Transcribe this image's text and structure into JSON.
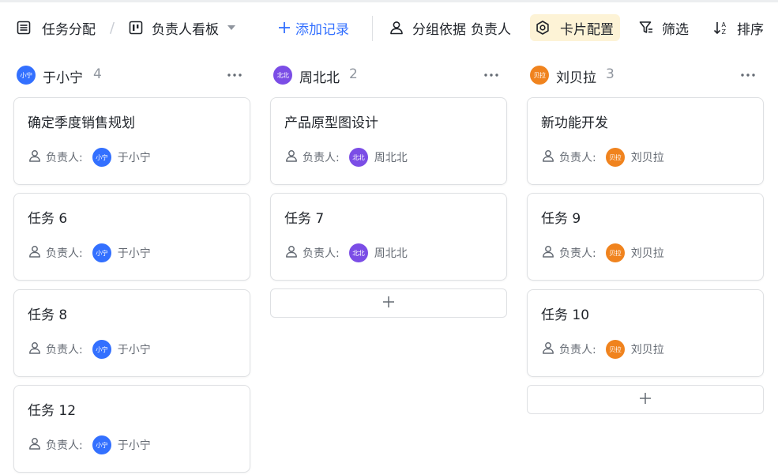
{
  "toolbar": {
    "view_title": "任务分配",
    "board_name": "负责人看板",
    "add_record": "添加记录",
    "group_by_label": "分组依据",
    "group_by_value": "负责人",
    "card_config": "卡片配置",
    "filter": "筛选",
    "sort": "排序"
  },
  "colors": {
    "accent": "#3370ff",
    "card_config_bg": "#fdf3d6",
    "avatar_blue": "#3370ff",
    "avatar_purple": "#7b4de6",
    "avatar_orange": "#f0831e"
  },
  "board": {
    "assignee_label": "负责人:",
    "columns": [
      {
        "name": "于小宁",
        "count": "4",
        "avatar": "小宁",
        "cards": [
          {
            "title": "确定季度销售规划",
            "assignee": "于小宁"
          },
          {
            "title": "任务 6",
            "assignee": "于小宁"
          },
          {
            "title": "任务 8",
            "assignee": "于小宁"
          },
          {
            "title": "任务  12",
            "assignee": "于小宁"
          }
        ]
      },
      {
        "name": "周北北",
        "count": "2",
        "avatar": "北北",
        "cards": [
          {
            "title": "产品原型图设计",
            "assignee": "周北北"
          },
          {
            "title": "任务 7",
            "assignee": "周北北"
          }
        ]
      },
      {
        "name": "刘贝拉",
        "count": "3",
        "avatar": "贝拉",
        "cards": [
          {
            "title": "新功能开发",
            "assignee": "刘贝拉"
          },
          {
            "title": "任务 9",
            "assignee": "刘贝拉"
          },
          {
            "title": "任务 10",
            "assignee": "刘贝拉"
          }
        ]
      }
    ]
  }
}
